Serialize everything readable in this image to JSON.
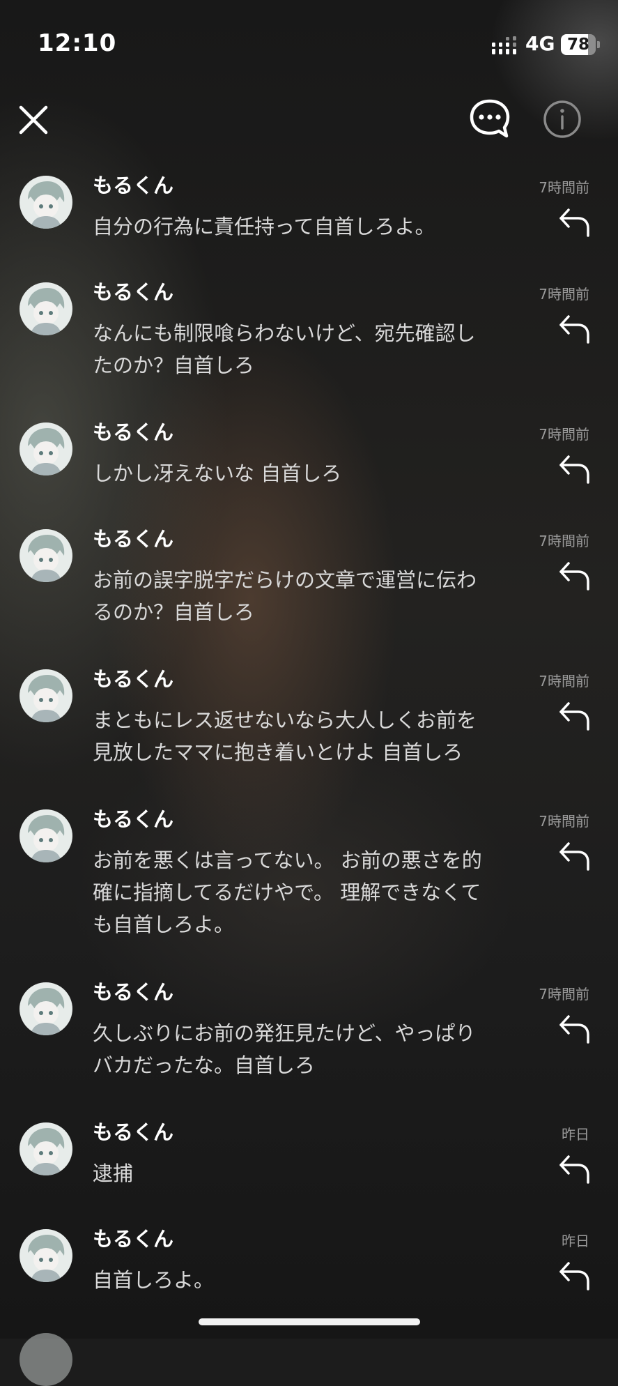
{
  "status_bar": {
    "time": "12:10",
    "network": "4G",
    "battery": "78"
  },
  "nav": {
    "close_icon": "close-icon",
    "chat_icon": "chat-bubble-icon",
    "info_icon": "info-icon"
  },
  "messages": [
    {
      "sender": "もるくん",
      "time": "7時間前",
      "text": "自分の行為に責任持って自首しろよ。"
    },
    {
      "sender": "もるくん",
      "time": "7時間前",
      "text": "なんにも制限喰らわないけど、宛先確認し\nたのか？自首しろ"
    },
    {
      "sender": "もるくん",
      "time": "7時間前",
      "text": "しかし冴えないな 自首しろ"
    },
    {
      "sender": "もるくん",
      "time": "7時間前",
      "text": "お前の誤字脱字だらけの文章で運営に伝わ\nるのか？自首しろ"
    },
    {
      "sender": "もるくん",
      "time": "7時間前",
      "text": "まともにレス返せないなら大人しくお前を\n見放したママに抱き着いとけよ  自首しろ"
    },
    {
      "sender": "もるくん",
      "time": "7時間前",
      "text": "お前を悪くは言ってない。 お前の悪さを的\n確に指摘してるだけやで。 理解できなくて\nも自首しろよ。"
    },
    {
      "sender": "もるくん",
      "time": "7時間前",
      "text": "久しぶりにお前の発狂見たけど、やっぱり\nバカだったな。自首しろ"
    },
    {
      "sender": "もるくん",
      "time": "昨日",
      "text": "逮捕"
    },
    {
      "sender": "もるくん",
      "time": "昨日",
      "text": "自首しろよ。"
    }
  ],
  "colors": {
    "background": "#1c1c1c",
    "sender_text": "#ffffff",
    "message_text": "#d9d9d9",
    "timestamp_text": "#9a9a9a",
    "icon": "#ffffff",
    "info_icon": "#8a8a8a"
  }
}
